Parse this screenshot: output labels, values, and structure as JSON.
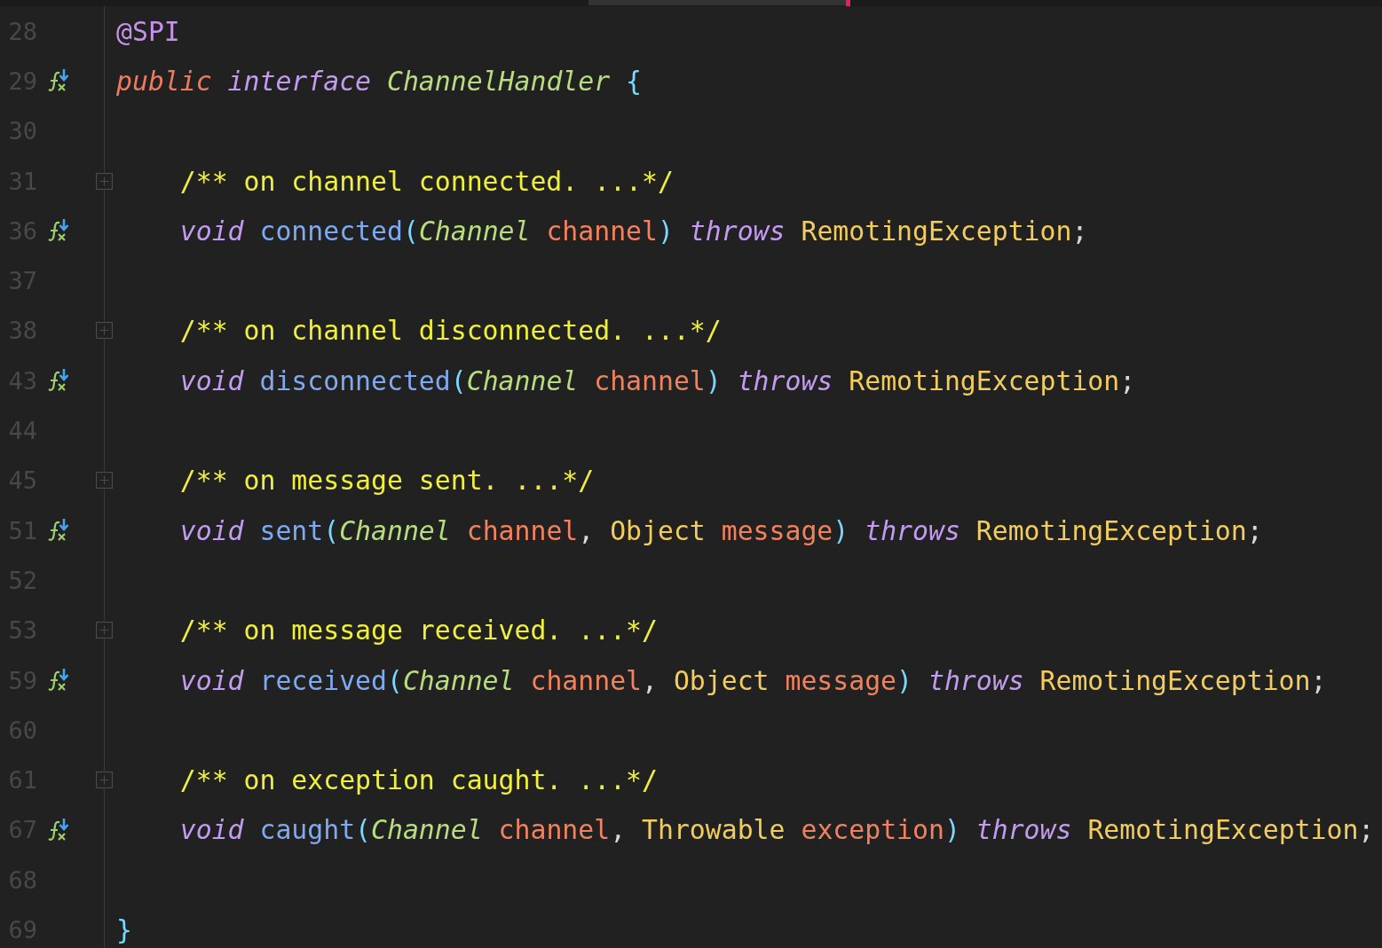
{
  "editor": {
    "lines": [
      {
        "number": "28",
        "gutter_icon": false,
        "fold": false,
        "indented": false,
        "tokens": [
          {
            "kind": "annotation",
            "text": "@SPI"
          }
        ]
      },
      {
        "number": "29",
        "gutter_icon": true,
        "fold": false,
        "indented": false,
        "tokens": [
          {
            "kind": "modifier",
            "text": "public "
          },
          {
            "kind": "keyword",
            "text": "interface "
          },
          {
            "kind": "class",
            "text": "ChannelHandler "
          },
          {
            "kind": "brace",
            "text": "{"
          }
        ]
      },
      {
        "number": "30",
        "gutter_icon": false,
        "fold": false,
        "indented": false
      },
      {
        "number": "31",
        "gutter_icon": false,
        "fold": true,
        "indented": true,
        "tokens": [
          {
            "kind": "comment",
            "text": "/** on channel connected. ...*/"
          }
        ]
      },
      {
        "number": "36",
        "gutter_icon": true,
        "fold": false,
        "indented": true,
        "tokens": [
          {
            "kind": "keyword",
            "text": "void "
          },
          {
            "kind": "method",
            "text": "connected"
          },
          {
            "kind": "brace",
            "text": "("
          },
          {
            "kind": "class",
            "text": "Channel "
          },
          {
            "kind": "param",
            "text": "channel"
          },
          {
            "kind": "brace",
            "text": ") "
          },
          {
            "kind": "keyword",
            "text": "throws "
          },
          {
            "kind": "type",
            "text": "RemotingException"
          },
          {
            "kind": "punct",
            "text": ";"
          }
        ]
      },
      {
        "number": "37",
        "gutter_icon": false,
        "fold": false,
        "indented": false
      },
      {
        "number": "38",
        "gutter_icon": false,
        "fold": true,
        "indented": true,
        "tokens": [
          {
            "kind": "comment",
            "text": "/** on channel disconnected. ...*/"
          }
        ]
      },
      {
        "number": "43",
        "gutter_icon": true,
        "fold": false,
        "indented": true,
        "tokens": [
          {
            "kind": "keyword",
            "text": "void "
          },
          {
            "kind": "method",
            "text": "disconnected"
          },
          {
            "kind": "brace",
            "text": "("
          },
          {
            "kind": "class",
            "text": "Channel "
          },
          {
            "kind": "param",
            "text": "channel"
          },
          {
            "kind": "brace",
            "text": ") "
          },
          {
            "kind": "keyword",
            "text": "throws "
          },
          {
            "kind": "type",
            "text": "RemotingException"
          },
          {
            "kind": "punct",
            "text": ";"
          }
        ]
      },
      {
        "number": "44",
        "gutter_icon": false,
        "fold": false,
        "indented": false
      },
      {
        "number": "45",
        "gutter_icon": false,
        "fold": true,
        "indented": true,
        "tokens": [
          {
            "kind": "comment",
            "text": "/** on message sent. ...*/"
          }
        ]
      },
      {
        "number": "51",
        "gutter_icon": true,
        "fold": false,
        "indented": true,
        "tokens": [
          {
            "kind": "keyword",
            "text": "void "
          },
          {
            "kind": "method",
            "text": "sent"
          },
          {
            "kind": "brace",
            "text": "("
          },
          {
            "kind": "class",
            "text": "Channel "
          },
          {
            "kind": "param",
            "text": "channel"
          },
          {
            "kind": "punct",
            "text": ", "
          },
          {
            "kind": "type",
            "text": "Object "
          },
          {
            "kind": "param",
            "text": "message"
          },
          {
            "kind": "brace",
            "text": ") "
          },
          {
            "kind": "keyword",
            "text": "throws "
          },
          {
            "kind": "type",
            "text": "RemotingException"
          },
          {
            "kind": "punct",
            "text": ";"
          }
        ]
      },
      {
        "number": "52",
        "gutter_icon": false,
        "fold": false,
        "indented": false
      },
      {
        "number": "53",
        "gutter_icon": false,
        "fold": true,
        "indented": true,
        "tokens": [
          {
            "kind": "comment",
            "text": "/** on message received. ...*/"
          }
        ]
      },
      {
        "number": "59",
        "gutter_icon": true,
        "fold": false,
        "indented": true,
        "tokens": [
          {
            "kind": "keyword",
            "text": "void "
          },
          {
            "kind": "method",
            "text": "received"
          },
          {
            "kind": "brace",
            "text": "("
          },
          {
            "kind": "class",
            "text": "Channel "
          },
          {
            "kind": "param",
            "text": "channel"
          },
          {
            "kind": "punct",
            "text": ", "
          },
          {
            "kind": "type",
            "text": "Object "
          },
          {
            "kind": "param",
            "text": "message"
          },
          {
            "kind": "brace",
            "text": ") "
          },
          {
            "kind": "keyword",
            "text": "throws "
          },
          {
            "kind": "type",
            "text": "RemotingException"
          },
          {
            "kind": "punct",
            "text": ";"
          }
        ]
      },
      {
        "number": "60",
        "gutter_icon": false,
        "fold": false,
        "indented": false
      },
      {
        "number": "61",
        "gutter_icon": false,
        "fold": true,
        "indented": true,
        "tokens": [
          {
            "kind": "comment",
            "text": "/** on exception caught. ...*/"
          }
        ]
      },
      {
        "number": "67",
        "gutter_icon": true,
        "fold": false,
        "indented": true,
        "tokens": [
          {
            "kind": "keyword",
            "text": "void "
          },
          {
            "kind": "method",
            "text": "caught"
          },
          {
            "kind": "brace",
            "text": "("
          },
          {
            "kind": "class",
            "text": "Channel "
          },
          {
            "kind": "param",
            "text": "channel"
          },
          {
            "kind": "punct",
            "text": ", "
          },
          {
            "kind": "type",
            "text": "Throwable "
          },
          {
            "kind": "param",
            "text": "exception"
          },
          {
            "kind": "brace",
            "text": ") "
          },
          {
            "kind": "keyword",
            "text": "throws "
          },
          {
            "kind": "type",
            "text": "RemotingException"
          },
          {
            "kind": "punct",
            "text": ";"
          }
        ]
      },
      {
        "number": "68",
        "gutter_icon": false,
        "fold": false,
        "indented": false
      },
      {
        "number": "69",
        "gutter_icon": false,
        "fold": false,
        "indented": false,
        "tokens": [
          {
            "kind": "brace",
            "text": "}"
          }
        ]
      }
    ]
  }
}
